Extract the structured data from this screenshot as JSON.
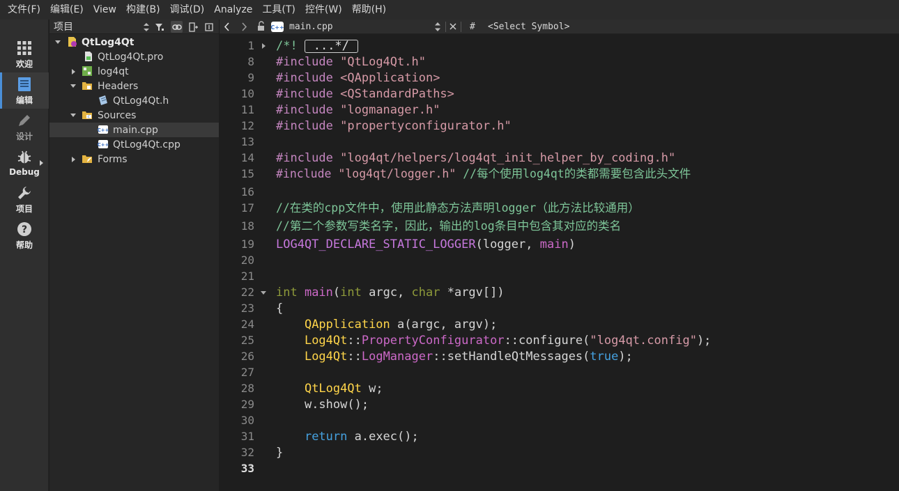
{
  "menubar": {
    "items": [
      "文件(F)",
      "编辑(E)",
      "View",
      "构建(B)",
      "调试(D)",
      "Analyze",
      "工具(T)",
      "控件(W)",
      "帮助(H)"
    ]
  },
  "modebar": {
    "items": [
      {
        "label": "欢迎",
        "icon": "grid-icon"
      },
      {
        "label": "编辑",
        "icon": "document-icon",
        "active": true
      },
      {
        "label": "设计",
        "icon": "pencil-icon"
      },
      {
        "label": "Debug",
        "icon": "bug-icon"
      },
      {
        "label": "项目",
        "icon": "wrench-icon"
      },
      {
        "label": "帮助",
        "icon": "question-icon"
      }
    ]
  },
  "project_pane": {
    "title": "项目",
    "tree": [
      {
        "label": "QtLog4Qt",
        "level": 0,
        "expanded": true,
        "icon": "qt-project-icon"
      },
      {
        "label": "QtLog4Qt.pro",
        "level": 1,
        "icon": "pro-file-icon"
      },
      {
        "label": "log4qt",
        "level": 1,
        "expanded": false,
        "icon": "subproject-icon"
      },
      {
        "label": "Headers",
        "level": 1,
        "expanded": true,
        "icon": "headers-folder-icon"
      },
      {
        "label": "QtLog4Qt.h",
        "level": 2,
        "icon": "header-file-icon"
      },
      {
        "label": "Sources",
        "level": 1,
        "expanded": true,
        "icon": "sources-folder-icon"
      },
      {
        "label": "main.cpp",
        "level": 2,
        "icon": "cpp-file-icon",
        "selected": true
      },
      {
        "label": "QtLog4Qt.cpp",
        "level": 2,
        "icon": "cpp-file-icon"
      },
      {
        "label": "Forms",
        "level": 1,
        "expanded": false,
        "icon": "forms-folder-icon"
      }
    ]
  },
  "editor_toolbar": {
    "file_name": "main.cpp",
    "hash": "#",
    "symbol_placeholder": "<Select Symbol>"
  },
  "editor": {
    "current_line": "33",
    "lines": [
      {
        "n": "1",
        "fold": "right"
      },
      {
        "n": "8"
      },
      {
        "n": "9"
      },
      {
        "n": "10"
      },
      {
        "n": "11"
      },
      {
        "n": "12"
      },
      {
        "n": "13"
      },
      {
        "n": "14"
      },
      {
        "n": "15"
      },
      {
        "n": "16"
      },
      {
        "n": "17"
      },
      {
        "n": "18"
      },
      {
        "n": "19"
      },
      {
        "n": "20"
      },
      {
        "n": "21"
      },
      {
        "n": "22",
        "fold": "down"
      },
      {
        "n": "23"
      },
      {
        "n": "24"
      },
      {
        "n": "25"
      },
      {
        "n": "26"
      },
      {
        "n": "27"
      },
      {
        "n": "28"
      },
      {
        "n": "29"
      },
      {
        "n": "30"
      },
      {
        "n": "31"
      },
      {
        "n": "32"
      },
      {
        "n": "33"
      }
    ],
    "code": {
      "l1": {
        "cmt": "/*!",
        "fold_text": "...*/"
      },
      "l8": {
        "pre": "#include",
        "str": "\"QtLog4Qt.h\""
      },
      "l9": {
        "pre": "#include",
        "str": "<QApplication>"
      },
      "l10": {
        "pre": "#include",
        "str": "<QStandardPaths>"
      },
      "l11": {
        "pre": "#include",
        "str": "\"logmanager.h\""
      },
      "l12": {
        "pre": "#include",
        "str": "\"propertyconfigurator.h\""
      },
      "l14": {
        "pre": "#include",
        "str": "\"log4qt/helpers/log4qt_init_helper_by_coding.h\""
      },
      "l15": {
        "pre": "#include",
        "str": "\"log4qt/logger.h\"",
        "cmt": "//每个使用log4qt的类都需要包含此头文件"
      },
      "l17": {
        "cmt": "//在类的cpp文件中，使用此静态方法声明logger（此方法比较通用）"
      },
      "l18": {
        "cmt": "//第二个参数写类名字，因此，输出的log条目中包含其对应的类名"
      },
      "l19": {
        "macro": "LOG4QT_DECLARE_STATIC_LOGGER",
        "open": "(",
        "arg1": "logger",
        "comma": ", ",
        "arg2": "main",
        "close": ")"
      },
      "l22": {
        "kw1": "int",
        "fn": " main",
        "p1": "(",
        "kw2": "int",
        "a1": " argc, ",
        "kw3": "char",
        "a2": " *argv[])"
      },
      "l23": {
        "text": "{"
      },
      "l24": {
        "indent": "    ",
        "type": "QApplication",
        "rest": " a(argc, argv);"
      },
      "l25": {
        "indent": "    ",
        "ns": "Log4Qt",
        "sep1": "::",
        "cls": "PropertyConfigurator",
        "sep2": "::",
        "m": "configure(",
        "str": "\"log4qt.config\"",
        "end": ");"
      },
      "l26": {
        "indent": "    ",
        "ns": "Log4Qt",
        "sep1": "::",
        "cls": "LogManager",
        "sep2": "::",
        "m": "setHandleQtMessages(",
        "bool": "true",
        "end": ");"
      },
      "l28": {
        "indent": "    ",
        "type": "QtLog4Qt",
        "rest": " w;"
      },
      "l29": {
        "indent": "    ",
        "text": "w.show();"
      },
      "l31": {
        "indent": "    ",
        "kw": "return",
        "rest": " a.exec();"
      },
      "l32": {
        "text": "}"
      }
    }
  },
  "colors": {
    "background": "#1e1e1e",
    "accent": "#4a8fd8",
    "string": "#d69aa7",
    "comment": "#7ec699",
    "preprocessor": "#ff6aad"
  }
}
